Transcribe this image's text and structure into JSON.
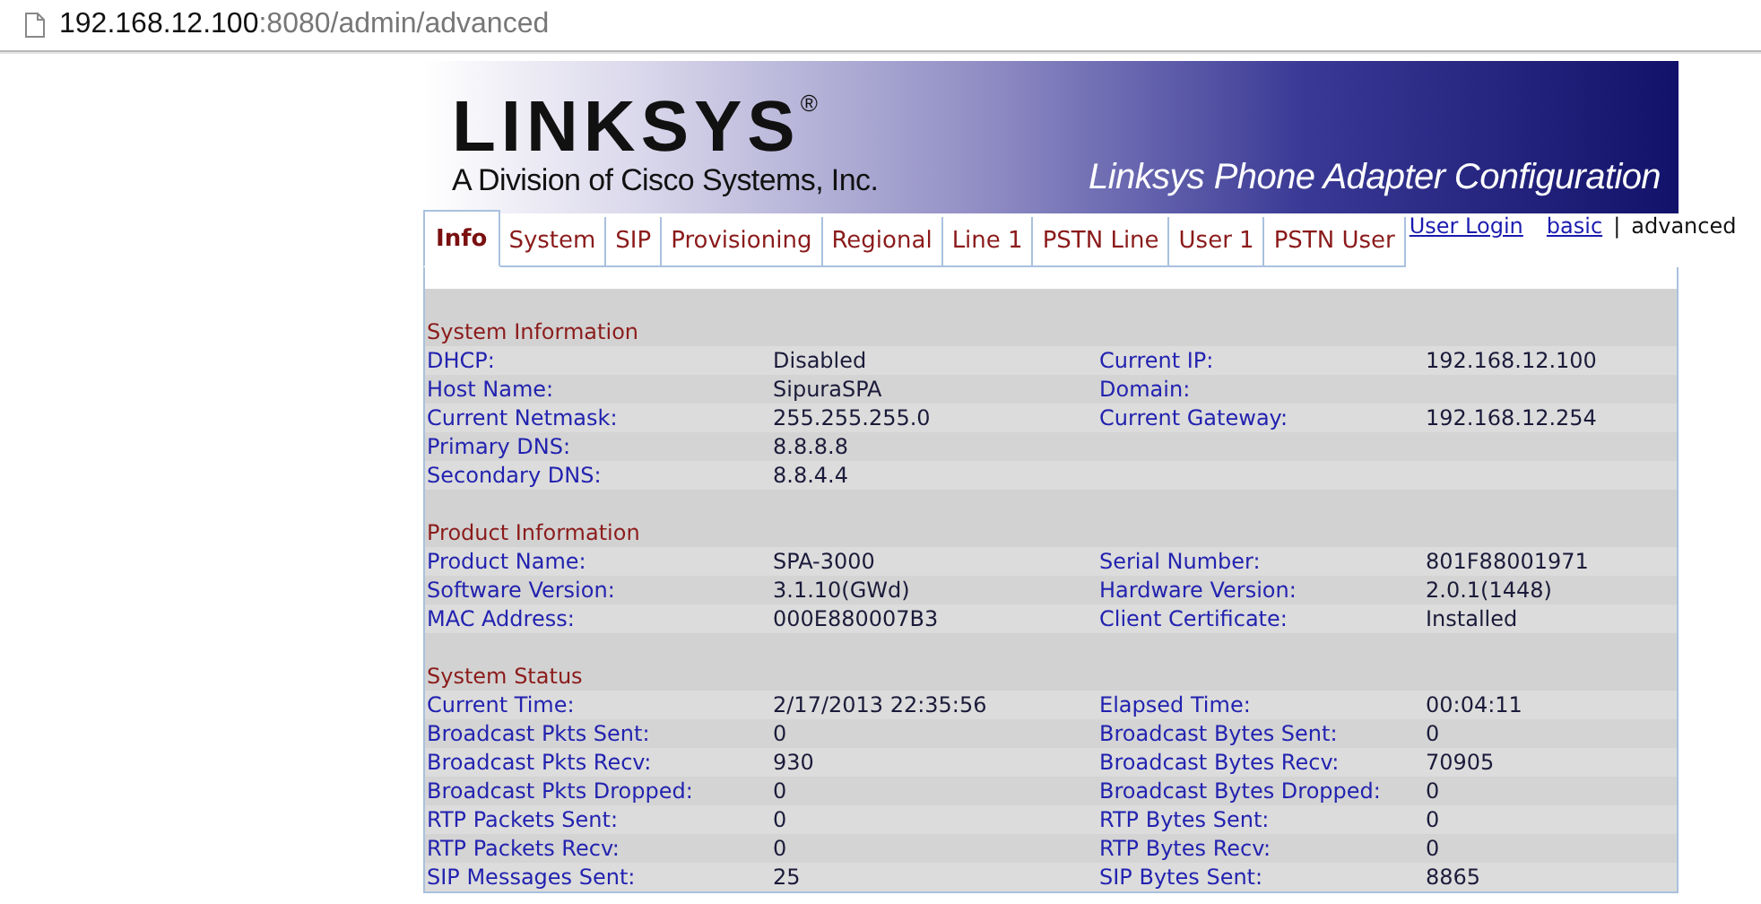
{
  "address_bar": {
    "host": "192.168.12.100",
    "rest": ":8080/admin/advanced"
  },
  "banner": {
    "logo": "LINKSYS",
    "registered": "®",
    "tagline": "A Division of Cisco Systems, Inc.",
    "title": "Linksys Phone Adapter Configuration"
  },
  "tabs": [
    {
      "label": "Info",
      "selected": true
    },
    {
      "label": "System",
      "selected": false
    },
    {
      "label": "SIP",
      "selected": false
    },
    {
      "label": "Provisioning",
      "selected": false
    },
    {
      "label": "Regional",
      "selected": false
    },
    {
      "label": "Line 1",
      "selected": false
    },
    {
      "label": "PSTN Line",
      "selected": false
    },
    {
      "label": "User 1",
      "selected": false
    },
    {
      "label": "PSTN User",
      "selected": false
    }
  ],
  "links": [
    {
      "label": "User Login",
      "selected": false
    },
    {
      "label": "basic",
      "selected": false
    },
    {
      "label": "|",
      "kind": "separator"
    },
    {
      "label": "advanced",
      "selected": true
    }
  ],
  "sections": [
    {
      "title": "System Information",
      "rows": [
        {
          "label_1": "DHCP:",
          "value_1": "Disabled",
          "label_2": "Current IP:",
          "value_2": "192.168.12.100"
        },
        {
          "label_1": "Host Name:",
          "value_1": "SipuraSPA",
          "label_2": "Domain:"
        },
        {
          "label_1": "Current Netmask:",
          "value_1": "255.255.255.0",
          "label_2": "Current Gateway:",
          "value_2": "192.168.12.254"
        },
        {
          "label_1": "Primary DNS:",
          "value_1": "8.8.8.8"
        },
        {
          "label_1": "Secondary DNS:",
          "value_1": "8.8.4.4"
        }
      ]
    },
    {
      "title": "Product Information",
      "rows": [
        {
          "label_1": "Product Name:",
          "value_1": "SPA-3000",
          "label_2": "Serial Number:",
          "value_2": "801F88001971"
        },
        {
          "label_1": "Software Version:",
          "value_1": "3.1.10(GWd)",
          "label_2": "Hardware Version:",
          "value_2": "2.0.1(1448)"
        },
        {
          "label_1": "MAC Address:",
          "value_1": "000E880007B3",
          "label_2": "Client Certificate:",
          "value_2": "Installed"
        }
      ]
    },
    {
      "title": "System Status",
      "rows": [
        {
          "label_1": "Current Time:",
          "value_1": "2/17/2013 22:35:56",
          "label_2": "Elapsed Time:",
          "value_2": "00:04:11"
        },
        {
          "label_1": "Broadcast Pkts Sent:",
          "value_1": "0",
          "label_2": "Broadcast Bytes Sent:",
          "value_2": "0"
        },
        {
          "label_1": "Broadcast Pkts Recv:",
          "value_1": "930",
          "label_2": "Broadcast Bytes Recv:",
          "value_2": "70905"
        },
        {
          "label_1": "Broadcast Pkts Dropped:",
          "value_1": "0",
          "label_2": "Broadcast Bytes Dropped:",
          "value_2": "0"
        },
        {
          "label_1": "RTP Packets Sent:",
          "value_1": "0",
          "label_2": "RTP Bytes Sent:",
          "value_2": "0"
        },
        {
          "label_1": "RTP Packets Recv:",
          "value_1": "0",
          "label_2": "RTP Bytes Recv:",
          "value_2": "0"
        },
        {
          "label_1": "SIP Messages Sent:",
          "value_1": "25",
          "label_2": "SIP Bytes Sent:",
          "value_2": "8865"
        }
      ]
    }
  ]
}
